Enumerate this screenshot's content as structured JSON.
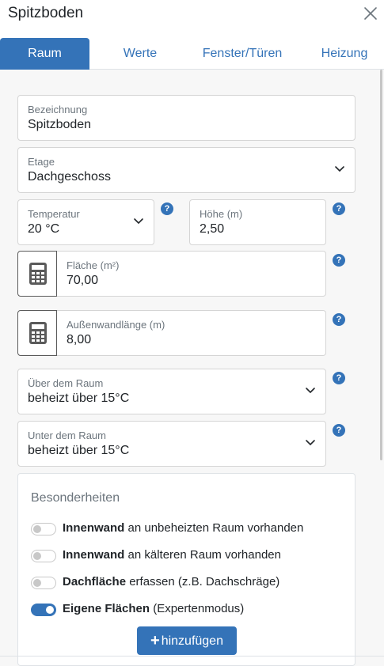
{
  "dialog": {
    "title": "Spitzboden",
    "close_icon": "close-icon"
  },
  "tabs": [
    {
      "label": "Raum",
      "active": true
    },
    {
      "label": "Werte",
      "active": false
    },
    {
      "label": "Fenster/Türen",
      "active": false
    },
    {
      "label": "Heizung",
      "active": false
    }
  ],
  "form": {
    "bezeichnung": {
      "label": "Bezeichnung",
      "value": "Spitzboden"
    },
    "etage": {
      "label": "Etage",
      "value": "Dachgeschoss"
    },
    "temperatur": {
      "label": "Temperatur",
      "value": "20 °C"
    },
    "hoehe": {
      "label": "Höhe (m)",
      "value": "2,50"
    },
    "flaeche": {
      "label": "Fläche (m²)",
      "value": "70,00"
    },
    "aussenwand": {
      "label": "Außenwandlänge (m)",
      "value": "8,00"
    },
    "ueber": {
      "label": "Über dem Raum",
      "value": "beheizt über 15°C"
    },
    "unter": {
      "label": "Unter dem Raum",
      "value": "beheizt über 15°C"
    },
    "help_glyph": "?"
  },
  "besonderheiten": {
    "title": "Besonderheiten",
    "toggles": [
      {
        "bold": "Innenwand",
        "rest": " an unbeheizten Raum vorhanden",
        "on": false
      },
      {
        "bold": "Innenwand",
        "rest": " an kälteren Raum vorhanden",
        "on": false
      },
      {
        "bold": "Dachfläche",
        "rest": " erfassen (z.B. Dachschräge)",
        "on": false
      },
      {
        "bold": "Eigene Flächen",
        "rest": " (Expertenmodus)",
        "on": true
      }
    ],
    "add_button": {
      "plus": "+",
      "label": "hinzufügen"
    }
  },
  "colors": {
    "accent": "#3473b8",
    "background": "#f7f7f7",
    "border": "#d5d5d5"
  }
}
